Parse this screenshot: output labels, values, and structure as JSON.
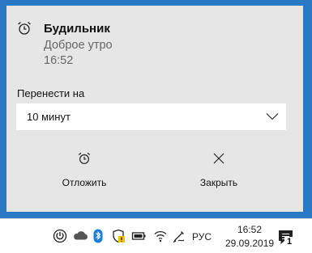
{
  "toast": {
    "app_name": "Будильник",
    "message": "Доброе утро",
    "time": "16:52",
    "snooze_label": "Перенести на",
    "snooze_selected": "10 минут",
    "actions": {
      "snooze": "Отложить",
      "dismiss": "Закрыть"
    }
  },
  "taskbar": {
    "language": "РУС",
    "clock_time": "16:52",
    "clock_date": "29.09.2019",
    "notification_count": "1",
    "tray_icons": [
      "power-icon",
      "onedrive-cloud-icon",
      "bluetooth-icon",
      "security-shield-icon",
      "battery-icon",
      "wifi-icon",
      "pen-icon"
    ]
  },
  "colors": {
    "desktop": "#2b78c4",
    "toast_bg": "#e6e6e6",
    "taskbar_bg": "#ffffff"
  }
}
